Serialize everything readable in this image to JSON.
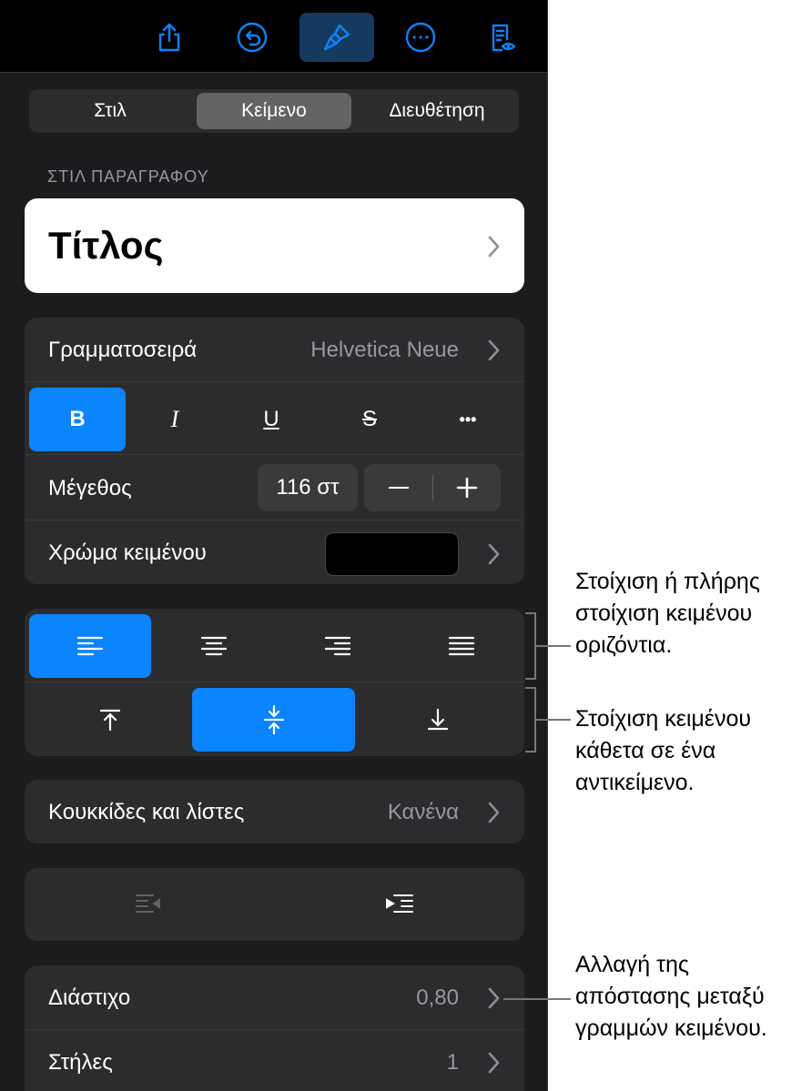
{
  "toolbar": {
    "icons": [
      "share-icon",
      "undo-icon",
      "format-brush-icon",
      "more-icon",
      "reading-view-icon"
    ],
    "active": "format-brush-icon"
  },
  "tabs": [
    {
      "label": "Στιλ",
      "active": false
    },
    {
      "label": "Κείμενο",
      "active": true
    },
    {
      "label": "Διευθέτηση",
      "active": false
    }
  ],
  "paragraph_style": {
    "section_label": "ΣΤΙΛ ΠΑΡΑΓΡΑΦΟΥ",
    "value": "Τίτλος"
  },
  "font": {
    "label": "Γραμματοσειρά",
    "value": "Helvetica Neue",
    "styles": [
      {
        "label": "B",
        "active": true
      },
      {
        "label": "I",
        "active": false
      },
      {
        "label": "U",
        "active": false
      },
      {
        "label": "S",
        "active": false
      },
      {
        "label": "•••",
        "active": false
      }
    ],
    "size_label": "Μέγεθος",
    "size_value": "116 στ",
    "minus": "−",
    "plus": "+",
    "color_label": "Χρώμα κειμένου",
    "color_value": "#000000"
  },
  "alignment": {
    "horizontal": [
      "align-left-icon",
      "align-center-icon",
      "align-right-icon",
      "justify-icon"
    ],
    "horizontal_active": 0,
    "vertical": [
      "align-top-icon",
      "align-middle-icon",
      "align-bottom-icon"
    ],
    "vertical_active": 1
  },
  "bullets": {
    "label": "Κουκκίδες και λίστες",
    "value": "Κανένα"
  },
  "indent": [
    "decrease-indent-icon",
    "increase-indent-icon"
  ],
  "spacing": {
    "label": "Διάστιχο",
    "value": "0,80"
  },
  "columns": {
    "label": "Στήλες",
    "value": "1"
  },
  "callouts": {
    "horizontal": [
      "Στοίχιση ή πλήρης",
      "στοίχιση κειμένου",
      "οριζόντια."
    ],
    "vertical": [
      "Στοίχιση κειμένου",
      "κάθετα σε ένα",
      "αντικείμενο."
    ],
    "spacing": [
      "Αλλαγή της",
      "απόστασης μεταξύ",
      "γραμμών κειμένου."
    ]
  },
  "colors": {
    "accent": "#0a84ff",
    "panel": "#1c1c1e",
    "card": "#2c2c2e"
  }
}
